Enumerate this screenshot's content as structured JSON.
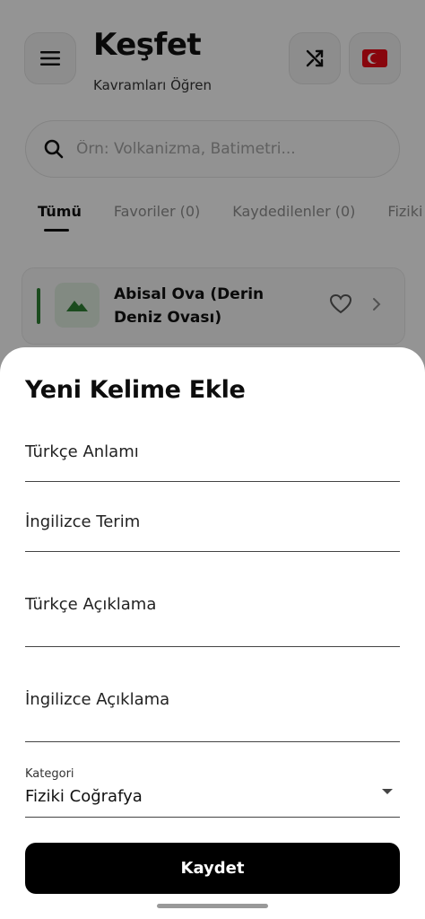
{
  "header": {
    "title": "Keşfet",
    "subtitle": "Kavramları Öğren"
  },
  "search": {
    "placeholder": "Örn: Volkanizma, Batimetri..."
  },
  "tabs": [
    {
      "label": "Tümü",
      "active": true
    },
    {
      "label": "Favoriler (0)",
      "active": false
    },
    {
      "label": "Kaydedilenler (0)",
      "active": false
    },
    {
      "label": "Fiziki C",
      "active": false
    }
  ],
  "card": {
    "title": "Abisal Ova (Derin Deniz Ovası)",
    "accent_color": "#2e7d32"
  },
  "sheet": {
    "title": "Yeni Kelime Ekle",
    "fields": {
      "turkish_meaning": "Türkçe Anlamı",
      "english_term": "İngilizce Terim",
      "turkish_description": "Türkçe Açıklama",
      "english_description": "İngilizce Açıklama"
    },
    "category": {
      "label": "Kategori",
      "value": "Fiziki Coğrafya"
    },
    "save_label": "Kaydet"
  }
}
